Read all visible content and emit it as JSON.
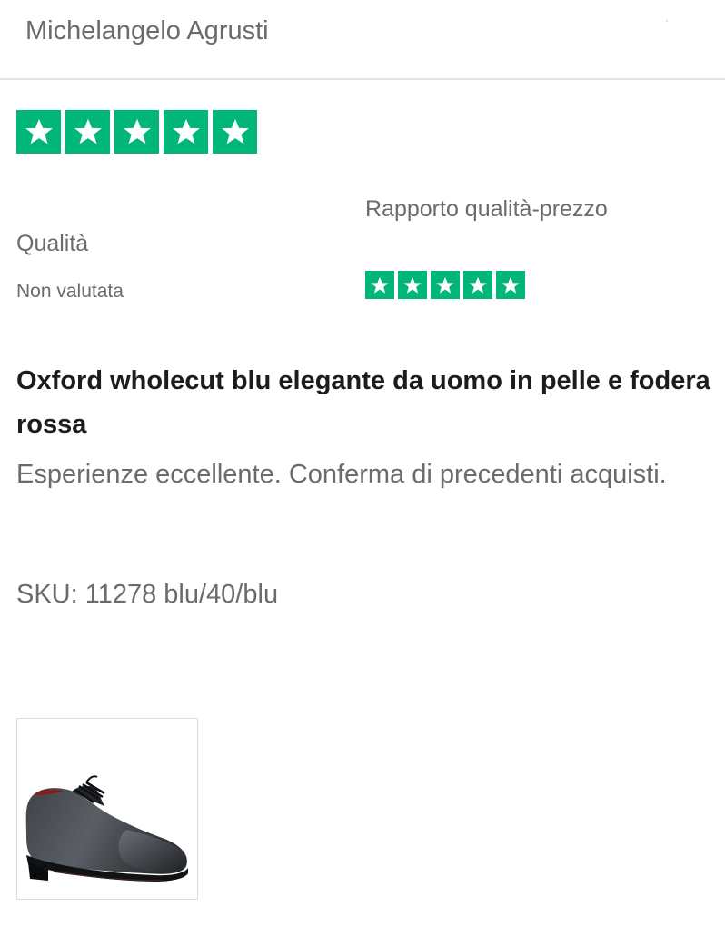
{
  "review": {
    "reviewer_name": "Michelangelo Agrusti",
    "overall_rating": 5,
    "overall_rating_max": 5,
    "attributes": {
      "quality": {
        "label": "Qualità",
        "value": "Non valutata"
      },
      "value_for_money": {
        "label": "Rapporto qualità-prezzo",
        "rating": 5,
        "rating_max": 5
      }
    },
    "product_title": "Oxford wholecut blu elegante da uomo in pelle e fodera rossa",
    "body": "Esperienze eccellente. Conferma di precedenti acquisti.",
    "sku_label": "SKU:",
    "sku_value": "11278 blu/40/blu",
    "photo_icon": "shoe-photo"
  },
  "colors": {
    "star_green": "#00b67a",
    "star_white": "#ffffff",
    "muted_text": "#6b6b6b",
    "title_text": "#1c1c1c",
    "divider": "#e5e5e5"
  }
}
